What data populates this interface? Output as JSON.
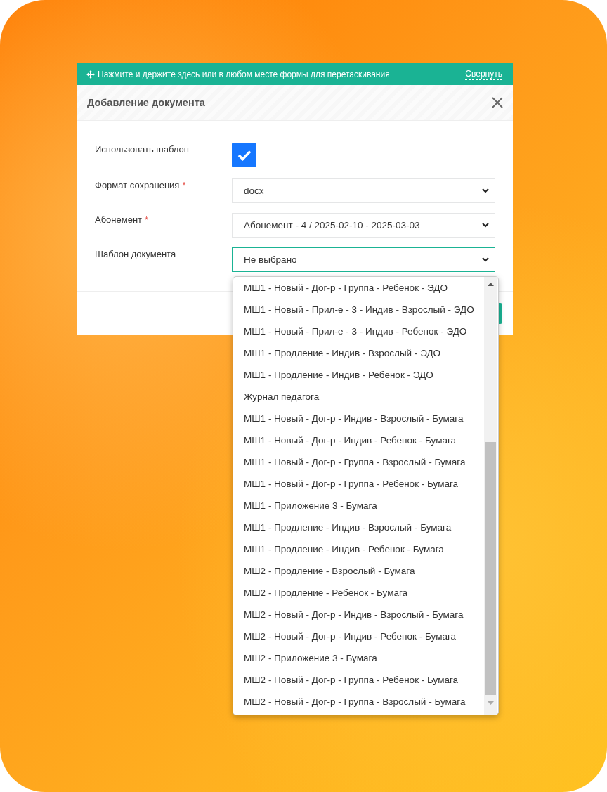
{
  "drag_bar": {
    "hint": "Нажмите и держите здесь или в любом месте формы для перетаскивания",
    "collapse_link": "Свернуть"
  },
  "dialog": {
    "title": "Добавление документа"
  },
  "fields": [
    {
      "kind": "checkbox",
      "label": "Использовать шаблон",
      "checked": true
    },
    {
      "kind": "select",
      "label": "Формат сохранения",
      "required_mark": "*",
      "value": "docx",
      "focused": false
    },
    {
      "kind": "select",
      "label": "Абонемент",
      "required_mark": "*",
      "value": "Абонемент - 4 / 2025-02-10 - 2025-03-03",
      "focused": false
    },
    {
      "kind": "select",
      "label": "Шаблон документа",
      "value": "Не выбрано",
      "focused": true
    }
  ],
  "dropdown": {
    "options": [
      "МШ1 - Новый - Дог-р - Группа - Ребенок - ЭДО",
      "МШ1 - Новый - Прил-е - 3 - Индив - Взрослый - ЭДО",
      "МШ1 - Новый - Прил-е - 3 - Индив - Ребенок - ЭДО",
      "МШ1 - Продление - Индив - Взрослый - ЭДО",
      "МШ1 - Продление - Индив - Ребенок - ЭДО",
      "Журнал педагога",
      "МШ1 - Новый - Дог-р - Индив - Взрослый - Бумага",
      "МШ1 - Новый - Дог-р - Индив - Ребенок - Бумага",
      "МШ1 - Новый - Дог-р - Группа - Взрослый - Бумага",
      "МШ1 - Новый - Дог-р - Группа - Ребенок - Бумага",
      "МШ1 - Приложение 3 - Бумага",
      "МШ1 - Продление - Индив - Взрослый - Бумага",
      "МШ1 - Продление - Индив - Ребенок - Бумага",
      "МШ2 - Продление - Взрослый - Бумага",
      "МШ2 - Продление - Ребенок - Бумага",
      "МШ2 - Новый - Дог-р - Индив - Взрослый - Бумага",
      "МШ2 - Новый - Дог-р - Индив - Ребенок - Бумага",
      "МШ2 - Приложение 3 - Бумага",
      "МШ2 - Новый - Дог-р - Группа - Ребенок - Бумага",
      "МШ2 - Новый - Дог-р - Группа - Взрослый - Бумага"
    ]
  }
}
